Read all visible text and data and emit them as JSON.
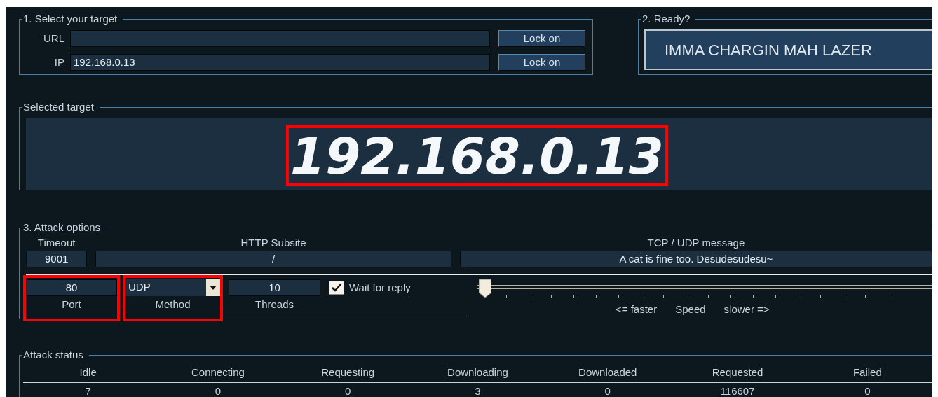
{
  "select_target": {
    "legend": "1. Select your target",
    "rows": [
      {
        "label": "URL",
        "button": "Lock on"
      },
      {
        "label": "IP",
        "value": "192.168.0.13",
        "button": "Lock on"
      }
    ]
  },
  "ready": {
    "legend": "2. Ready?",
    "button": "IMMA CHARGIN MAH LAZER"
  },
  "selected_target": {
    "legend": "Selected target",
    "value": "192.168.0.13",
    "highlighted": true
  },
  "attack_options": {
    "legend": "3. Attack options",
    "timeout": {
      "label": "Timeout",
      "value": "9001"
    },
    "subsite": {
      "label": "HTTP Subsite",
      "value": "/"
    },
    "message": {
      "label": "TCP / UDP message",
      "value": "A cat is fine too. Desudesudesu~"
    },
    "port": {
      "label": "Port",
      "value": "80",
      "highlighted": true
    },
    "method": {
      "label": "Method",
      "value": "UDP",
      "highlighted": true
    },
    "threads": {
      "label": "Threads",
      "value": "10"
    },
    "wait_for_reply": {
      "label": "Wait for reply",
      "checked": true
    },
    "speed": {
      "level": 0.01,
      "faster": "<= faster",
      "label": "Speed",
      "slower": "slower =>"
    }
  },
  "attack_status": {
    "legend": "Attack status",
    "columns": [
      {
        "label": "Idle",
        "value": "7"
      },
      {
        "label": "Connecting",
        "value": "0"
      },
      {
        "label": "Requesting",
        "value": "0"
      },
      {
        "label": "Downloading",
        "value": "3"
      },
      {
        "label": "Downloaded",
        "value": "0"
      },
      {
        "label": "Requested",
        "value": "116607"
      },
      {
        "label": "Failed",
        "value": "0"
      }
    ]
  }
}
